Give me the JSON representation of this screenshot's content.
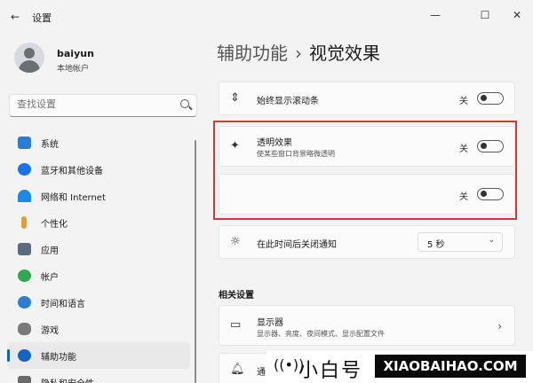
{
  "app": {
    "title": "设置",
    "back_glyph": "←",
    "minimize_glyph": "—",
    "maximize_glyph": "☐",
    "close_glyph": "✕"
  },
  "profile": {
    "name": "baiyun",
    "account_type": "本地帐户"
  },
  "search": {
    "placeholder": "查找设置"
  },
  "nav": {
    "items": [
      {
        "label": "系统",
        "color": "#2b7cd3"
      },
      {
        "label": "蓝牙和其他设备",
        "color": "#1a73e8"
      },
      {
        "label": "网络和 Internet",
        "color": "#1e88e5"
      },
      {
        "label": "个性化",
        "color": "#e0a030"
      },
      {
        "label": "应用",
        "color": "#5a6b7d"
      },
      {
        "label": "帐户",
        "color": "#2fa84f"
      },
      {
        "label": "时间和语言",
        "color": "#2a7fd4"
      },
      {
        "label": "游戏",
        "color": "#7a7a7a"
      },
      {
        "label": "辅助功能",
        "color": "#1565c0"
      },
      {
        "label": "隐私和安全性",
        "color": "#6b6b6b"
      }
    ],
    "active_index": 8
  },
  "page": {
    "breadcrumb_parent": "辅助功能",
    "separator": "›",
    "title": "视觉效果"
  },
  "settings": {
    "scrollbars": {
      "icon": "⇕",
      "title": "始终显示滚动条",
      "state": "关"
    },
    "transparency": {
      "icon": "✦",
      "title": "透明效果",
      "subtitle": "使某些窗口背景略微透明",
      "state": "关"
    },
    "animation": {
      "state": "关"
    },
    "notifications": {
      "icon": "☼",
      "title": "在此时间后关闭通知",
      "value": "5 秒"
    }
  },
  "related": {
    "section_title": "相关设置",
    "display": {
      "icon": "▭",
      "title": "显示器",
      "subtitle": "显示器、亮度、夜间模式、显示配置文件"
    },
    "next_title_partial": "通"
  },
  "watermark": {
    "radio_glyph": "((•))",
    "cn": "小白号",
    "en": "XIAOBAIHAO.COM"
  },
  "colors": {
    "highlight_border": "#d23a3a",
    "accent": "#0067c0"
  }
}
